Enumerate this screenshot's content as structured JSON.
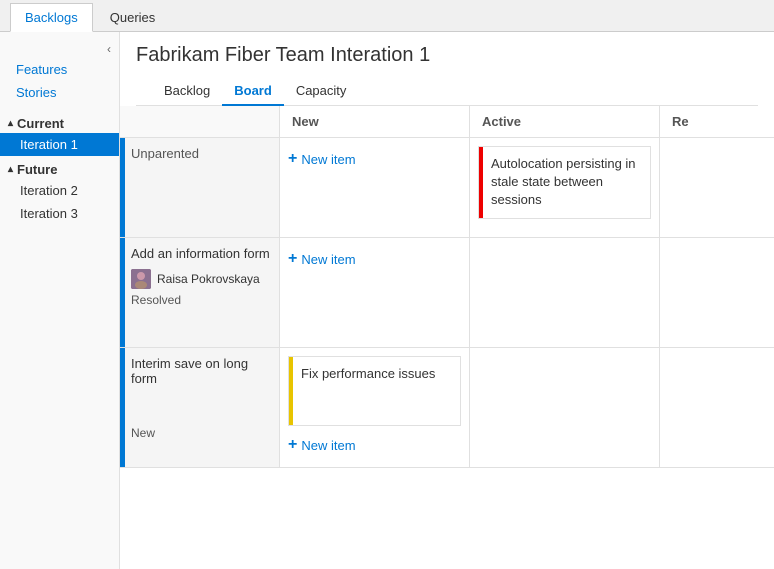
{
  "topTabs": {
    "tabs": [
      {
        "label": "Backlogs",
        "active": true
      },
      {
        "label": "Queries",
        "active": false
      }
    ]
  },
  "sidebar": {
    "collapseIcon": "‹",
    "links": [
      {
        "label": "Features"
      },
      {
        "label": "Stories"
      }
    ],
    "sections": [
      {
        "label": "Current",
        "expanded": true,
        "items": [
          {
            "label": "Iteration 1",
            "selected": true
          }
        ]
      },
      {
        "label": "Future",
        "expanded": true,
        "items": [
          {
            "label": "Iteration 2",
            "selected": false
          },
          {
            "label": "Iteration 3",
            "selected": false
          }
        ]
      }
    ]
  },
  "content": {
    "title": "Fabrikam Fiber Team Interation 1",
    "navTabs": [
      {
        "label": "Backlog",
        "active": false
      },
      {
        "label": "Board",
        "active": true
      },
      {
        "label": "Capacity",
        "active": false
      }
    ],
    "board": {
      "columns": [
        {
          "label": ""
        },
        {
          "label": "New"
        },
        {
          "label": "Active"
        },
        {
          "label": "Re"
        }
      ],
      "rows": [
        {
          "label": "",
          "newCell": {
            "card": null,
            "newItemLabel": "New item"
          },
          "activeCell": {
            "card": {
              "title": "Autolocation persisting in stale state between sessions",
              "borderColor": "red"
            }
          },
          "resolvedCell": {}
        },
        {
          "label": "",
          "newCell": {
            "newItemLabel": "New item"
          },
          "activeCell": {},
          "resolvedCell": {}
        },
        {
          "label": "",
          "newCell": {
            "card": {
              "title": "Fix performance issues",
              "borderColor": "yellow"
            },
            "newItemLabel": "New item"
          },
          "activeCell": {},
          "resolvedCell": {}
        }
      ],
      "cards": {
        "unparented": "Unparented",
        "row1Active": "Autolocation persisting in stale state between sessions",
        "row2Label": "Add an information form",
        "row2User": "Raisa Pokrovskaya",
        "row2Status": "Resolved",
        "row3Label": "Interim save on long form",
        "row3Status": "New",
        "row3Active": "Fix performance issues",
        "newItem": "New item"
      }
    }
  }
}
